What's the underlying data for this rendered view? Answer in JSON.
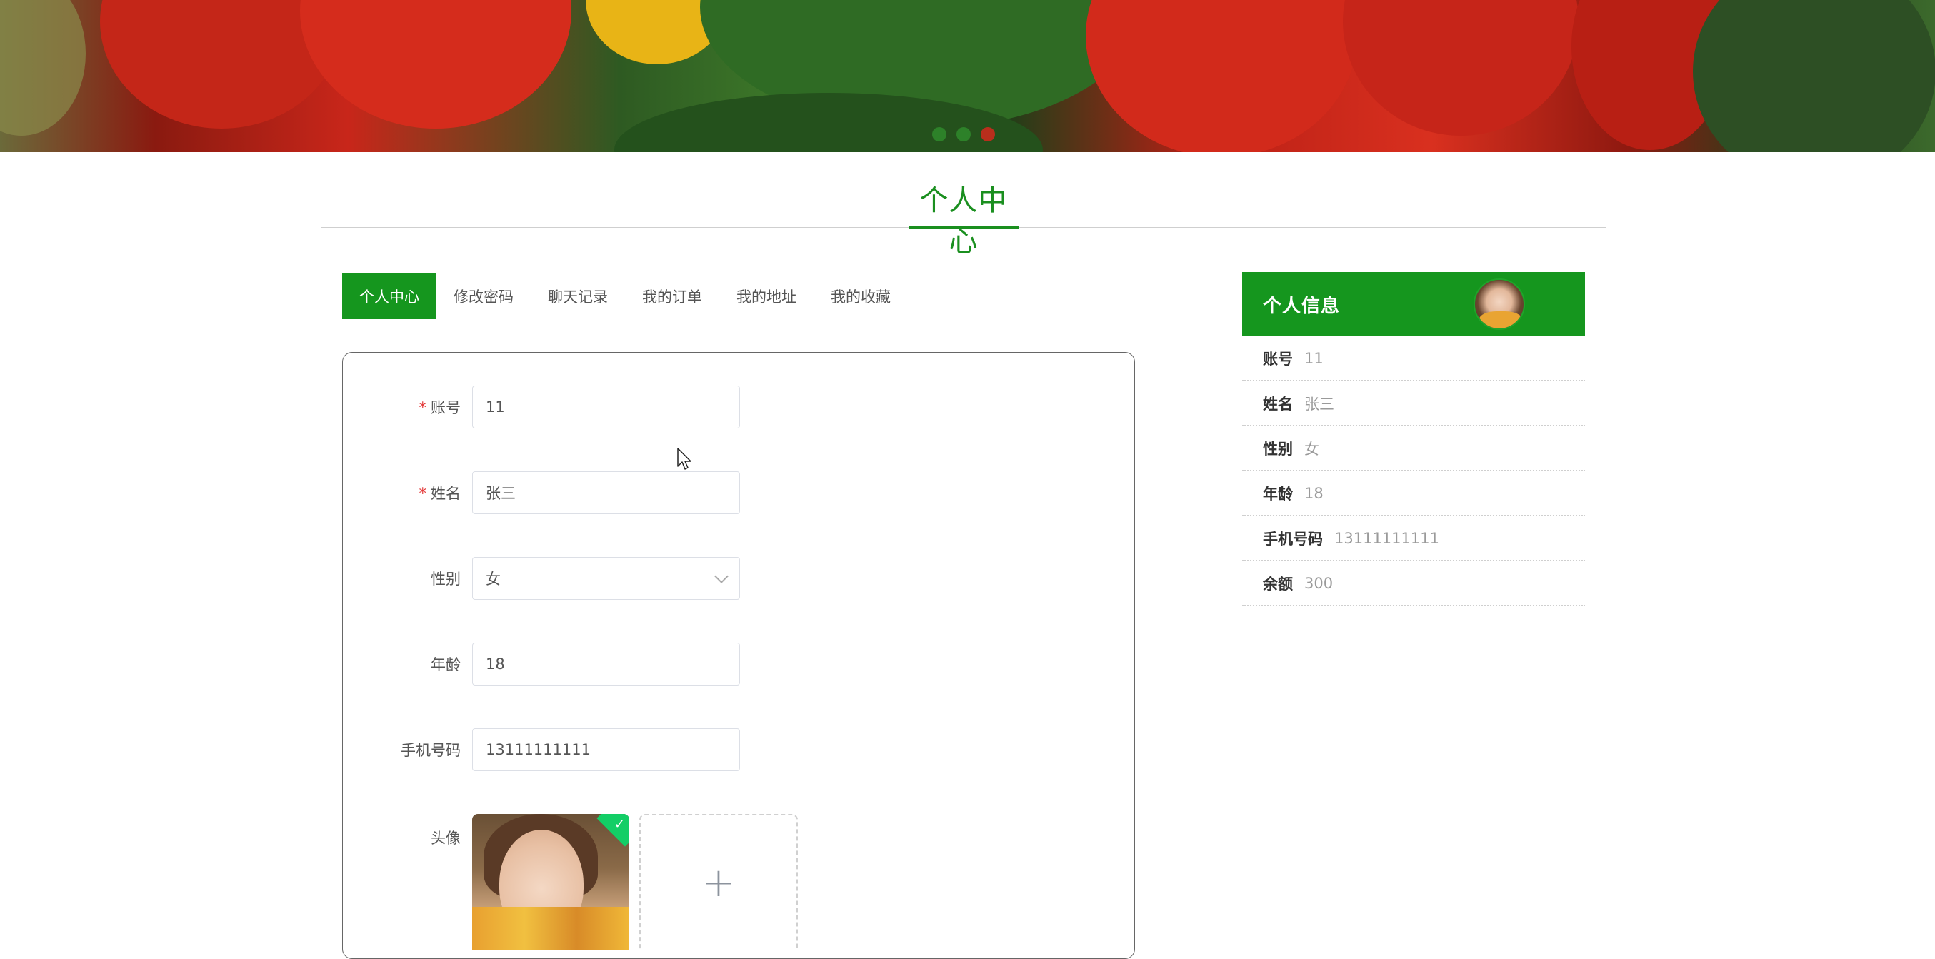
{
  "banner": {
    "slides": [
      {
        "name": "slide-1",
        "active": false
      },
      {
        "name": "slide-2",
        "active": false
      },
      {
        "name": "slide-3",
        "active": true
      }
    ]
  },
  "section": {
    "title": "个人中心"
  },
  "tabs": [
    {
      "label": "个人中心",
      "active": true
    },
    {
      "label": "修改密码",
      "active": false
    },
    {
      "label": "聊天记录",
      "active": false
    },
    {
      "label": "我的订单",
      "active": false
    },
    {
      "label": "我的地址",
      "active": false
    },
    {
      "label": "我的收藏",
      "active": false
    }
  ],
  "form": {
    "account": {
      "label": "账号",
      "required": "*",
      "value": "11"
    },
    "name": {
      "label": "姓名",
      "required": "*",
      "value": "张三"
    },
    "gender": {
      "label": "性别",
      "value": "女"
    },
    "age": {
      "label": "年龄",
      "value": "18"
    },
    "phone": {
      "label": "手机号码",
      "value": "13111111111"
    },
    "avatar": {
      "label": "头像",
      "upload_symbol": "+",
      "check_symbol": "✓"
    }
  },
  "info_card": {
    "title": "个人信息",
    "rows": [
      {
        "key": "账号",
        "value": "11"
      },
      {
        "key": "姓名",
        "value": "张三"
      },
      {
        "key": "性别",
        "value": "女"
      },
      {
        "key": "年龄",
        "value": "18"
      },
      {
        "key": "手机号码",
        "value": "13111111111"
      },
      {
        "key": "余额",
        "value": "300"
      }
    ]
  },
  "colors": {
    "brand_green": "#15961e",
    "required_red": "#e33b3b",
    "success_green": "#13ce66"
  }
}
